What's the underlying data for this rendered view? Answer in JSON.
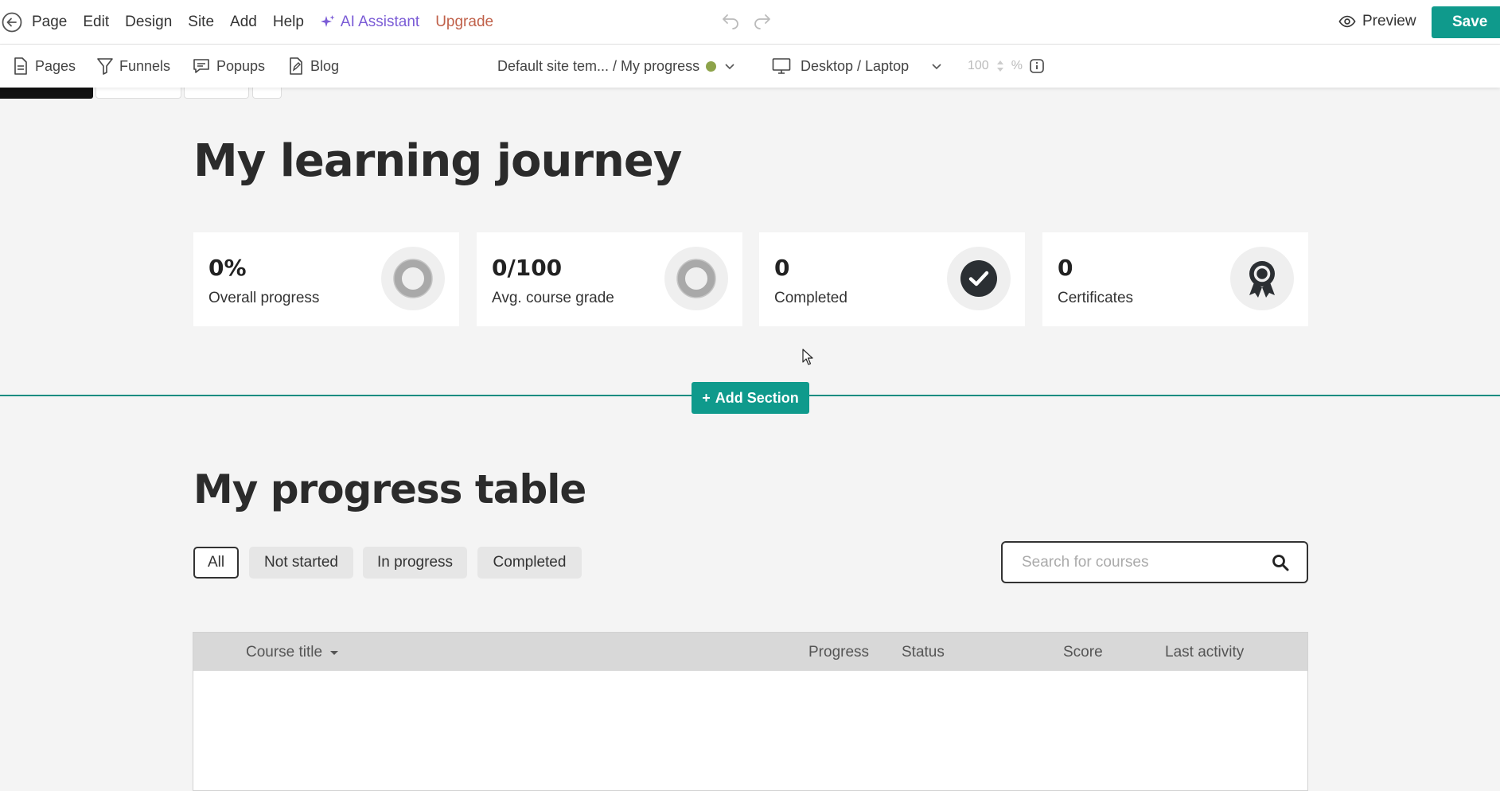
{
  "menubar": {
    "items": [
      "Page",
      "Edit",
      "Design",
      "Site",
      "Add",
      "Help"
    ],
    "ai_label": "AI Assistant",
    "upgrade_label": "Upgrade",
    "preview_label": "Preview",
    "save_label": "Save"
  },
  "toolbar": {
    "pages_label": "Pages",
    "funnels_label": "Funnels",
    "popups_label": "Popups",
    "blog_label": "Blog",
    "breadcrumb": "Default site tem...  / My progress",
    "device_label": "Desktop / Laptop",
    "zoom_value": "100",
    "zoom_unit": "%"
  },
  "main": {
    "title": "My learning journey",
    "cards": [
      {
        "value": "0%",
        "label": "Overall progress",
        "icon": "progress-ring-icon"
      },
      {
        "value": "0/100",
        "label": "Avg. course grade",
        "icon": "grade-ring-icon"
      },
      {
        "value": "0",
        "label": "Completed",
        "icon": "check-circle-icon"
      },
      {
        "value": "0",
        "label": "Certificates",
        "icon": "award-ribbon-icon"
      }
    ],
    "add_section_label": "Add Section",
    "table_title": "My progress table",
    "filters": [
      "All",
      "Not started",
      "In progress",
      "Completed"
    ],
    "search_placeholder": "Search for courses",
    "columns": {
      "course_title": "Course title",
      "progress": "Progress",
      "status": "Status",
      "score": "Score",
      "last_activity": "Last activity"
    }
  },
  "colors": {
    "accent": "#0f9a8c",
    "ai": "#7b5cd6",
    "upgrade": "#c0614a",
    "status_dot": "#8da34a"
  }
}
